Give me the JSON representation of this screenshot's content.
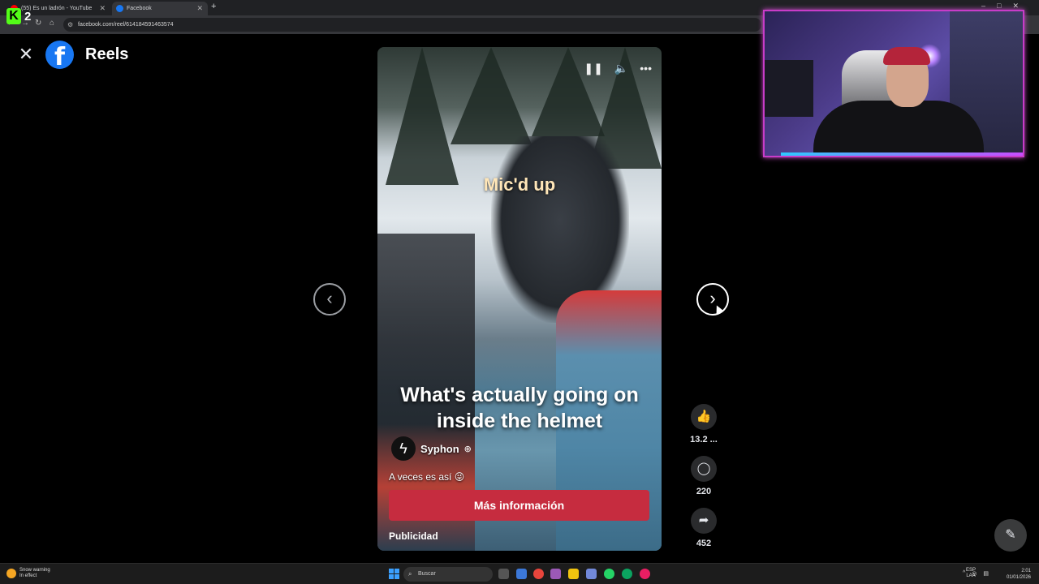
{
  "browser": {
    "tabs": [
      {
        "label": "(55) Es un ladrón - YouTube",
        "favicon": "youtube-icon"
      },
      {
        "label": "Facebook",
        "favicon": "facebook-icon",
        "active": true
      }
    ],
    "url": "facebook.com/reel/614184591463574"
  },
  "overlay": {
    "kick_count": "2"
  },
  "header": {
    "title": "Reels"
  },
  "reel": {
    "top_text": "Mic'd up",
    "caption": "What's actually going on inside the helmet",
    "author": "Syphon",
    "post_text": "A veces es así 😜",
    "cta_label": "Más información",
    "ad_label": "Publicidad"
  },
  "actions": {
    "likes": "13.2 ...",
    "comments": "220",
    "shares": "452"
  },
  "taskbar": {
    "weather_title": "Snow warning",
    "weather_sub": "In effect",
    "search_placeholder": "Buscar",
    "lang1": "ESP",
    "lang2": "LAA",
    "time": "2:01",
    "date": "01/01/2026"
  },
  "colors": {
    "facebook_blue": "#1877f2",
    "cta_red": "#c62c3f",
    "webcam_border": "#c83cc8"
  }
}
